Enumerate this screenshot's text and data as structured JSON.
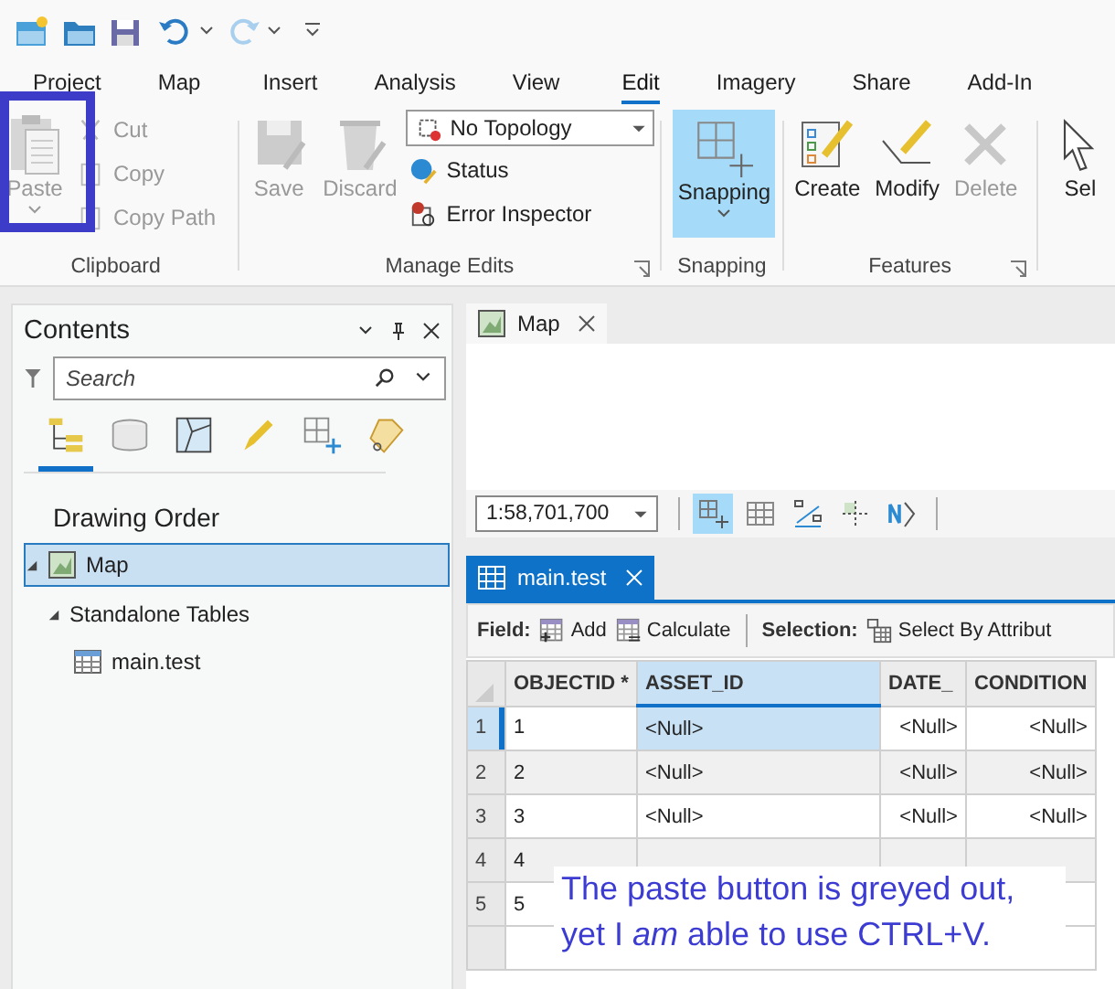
{
  "ribbon_tabs": [
    {
      "label": "Project",
      "selected": false
    },
    {
      "label": "Map",
      "selected": false
    },
    {
      "label": "Insert",
      "selected": false
    },
    {
      "label": "Analysis",
      "selected": false
    },
    {
      "label": "View",
      "selected": false
    },
    {
      "label": "Edit",
      "selected": true
    },
    {
      "label": "Imagery",
      "selected": false
    },
    {
      "label": "Share",
      "selected": false
    },
    {
      "label": "Add-In",
      "selected": false
    }
  ],
  "clipboard": {
    "label": "Clipboard",
    "paste": {
      "label": "Paste",
      "disabled": true
    },
    "small": [
      {
        "label": "Cut",
        "disabled": true
      },
      {
        "label": "Copy",
        "disabled": true
      },
      {
        "label": "Copy Path",
        "disabled": true
      }
    ]
  },
  "manage_edits": {
    "label": "Manage Edits",
    "buttons": [
      {
        "label": "Save",
        "disabled": true
      },
      {
        "label": "Discard",
        "disabled": true
      }
    ],
    "topology": "No Topology",
    "small": [
      {
        "label": "Status",
        "disabled": false
      },
      {
        "label": "Error Inspector",
        "disabled": false
      }
    ]
  },
  "snapping": {
    "label": "Snapping",
    "button": {
      "label": "Snapping",
      "selected": true
    }
  },
  "features": {
    "label": "Features",
    "buttons": [
      {
        "label": "Create",
        "disabled": false
      },
      {
        "label": "Modify",
        "disabled": false
      },
      {
        "label": "Delete",
        "disabled": true
      }
    ]
  },
  "select_button": {
    "label": "Sel"
  },
  "contents": {
    "title": "Contents",
    "search": {
      "placeholder": "Search"
    },
    "views": [
      {
        "selected": true
      },
      {
        "selected": false
      },
      {
        "selected": false
      },
      {
        "selected": false
      },
      {
        "selected": false
      },
      {
        "selected": false
      }
    ],
    "heading": "Drawing Order",
    "tree": [
      {
        "label": "Map",
        "expanded": true,
        "selected": true,
        "children": [
          {
            "label": "Standalone Tables",
            "expanded": true,
            "selected": false,
            "children": [
              {
                "label": "main.test",
                "selected": false
              }
            ]
          }
        ]
      }
    ]
  },
  "map_view": {
    "tab": "Map",
    "scale": "1:58,701,700"
  },
  "table_view": {
    "tab": "main.test",
    "field_label": "Field:",
    "field_buttons": [
      "Add",
      "Calculate"
    ],
    "selection_label": "Selection:",
    "selection_buttons": [
      "Select By Attribut"
    ],
    "columns": [
      {
        "label": "OBJECTID *",
        "selected": false
      },
      {
        "label": "ASSET_ID",
        "selected": true
      },
      {
        "label": "DATE_",
        "selected": false
      },
      {
        "label": "CONDITION",
        "selected": false
      }
    ],
    "rows": [
      {
        "index": "1",
        "selected": true,
        "cells": [
          "1",
          "<Null>",
          "<Null>",
          "<Null>"
        ]
      },
      {
        "index": "2",
        "selected": false,
        "cells": [
          "2",
          "<Null>",
          "<Null>",
          "<Null>"
        ]
      },
      {
        "index": "3",
        "selected": false,
        "cells": [
          "3",
          "<Null>",
          "<Null>",
          "<Null>"
        ]
      },
      {
        "index": "4",
        "selected": false,
        "cells": [
          "4"
        ]
      },
      {
        "index": "5",
        "selected": false,
        "cells": [
          "5"
        ]
      }
    ]
  },
  "annotation": {
    "text": "The paste button is greyed out,\nyet I *am* able to use CTRL+V."
  }
}
